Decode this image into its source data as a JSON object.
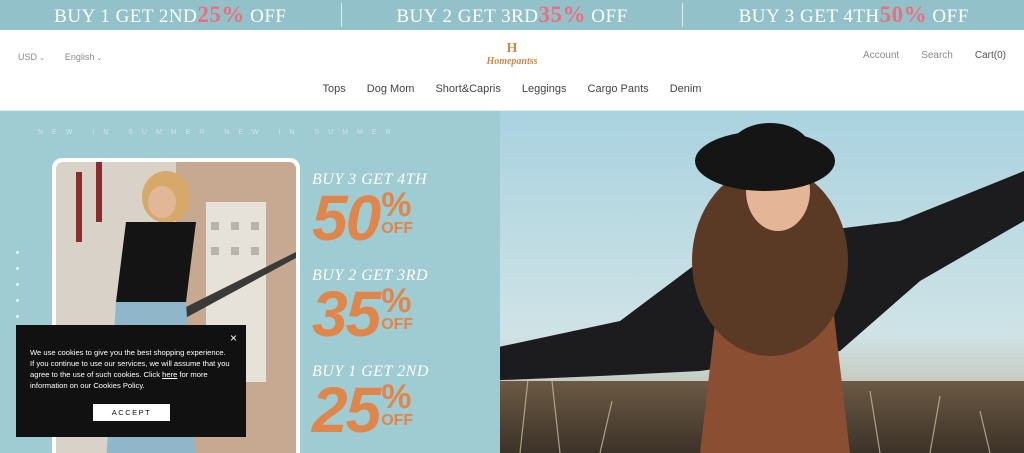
{
  "promo": [
    {
      "before": "BUY 1 GET 2ND",
      "percent": "25%",
      "after": "OFF"
    },
    {
      "before": "BUY 2 GET 3RD",
      "percent": "35%",
      "after": "OFF"
    },
    {
      "before": "BUY 3 GET 4TH",
      "percent": "50%",
      "after": "OFF"
    }
  ],
  "header": {
    "currency": "USD",
    "language": "English",
    "logo_mark": "H",
    "logo_text": "Homepantss",
    "account": "Account",
    "search": "Search",
    "cart": "Cart(0)"
  },
  "nav": [
    "Tops",
    "Dog Mom",
    "Short&Capris",
    "Leggings",
    "Cargo Pants",
    "Denim"
  ],
  "hero": {
    "marquee": "NEW IN SUMMER NEW IN SUMMER",
    "offers": [
      {
        "head": "BUY 3 GET 4TH",
        "num": "50",
        "pct": "%",
        "off": "OFF"
      },
      {
        "head": "BUY 2 GET 3RD",
        "num": "35",
        "pct": "%",
        "off": "OFF"
      },
      {
        "head": "BUY 1 GET 2ND",
        "num": "25",
        "pct": "%",
        "off": "OFF"
      }
    ]
  },
  "cookie": {
    "text_before": "We use cookies to give you the best shopping experience. If you continue to use our services, we will assume that you agree to the use of such cookies. Click ",
    "link": "here",
    "text_after": " for more information on our Cookies Policy.",
    "close": "×",
    "accept": "ACCEPT"
  },
  "colors": {
    "promo_bg": "#93c1c9",
    "promo_accent": "#ee6d7c",
    "hero_teal": "#9fcbd2",
    "offer_orange": "#e0864a",
    "logo_gold": "#c78b4a"
  }
}
